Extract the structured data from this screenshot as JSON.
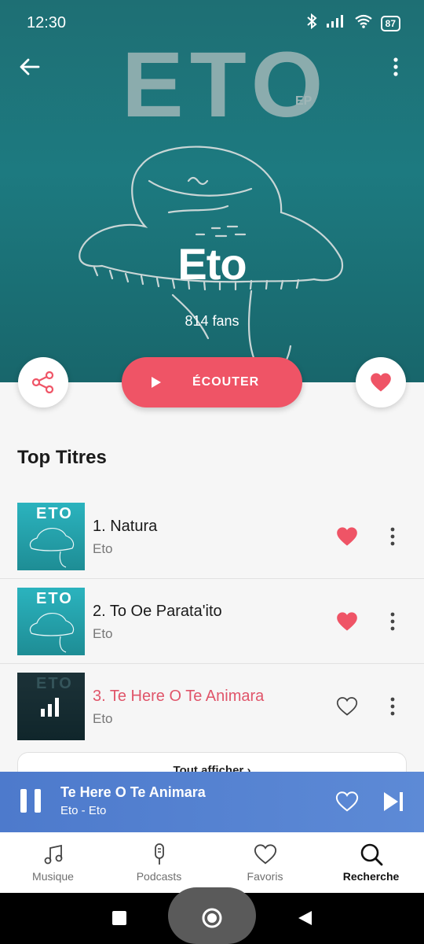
{
  "status_bar": {
    "time": "12:30",
    "battery": "87"
  },
  "artist": {
    "name": "Eto",
    "fans": "814 fans",
    "cover_text": "ETO",
    "cover_ep": "EP"
  },
  "actions": {
    "play_label": "ÉCOUTER"
  },
  "section_title": "Top Titres",
  "tracks": [
    {
      "title": "1. Natura",
      "artist": "Eto",
      "liked": true,
      "playing": false,
      "cover_text": "ETO"
    },
    {
      "title": "2. To Oe Parata'ito",
      "artist": "Eto",
      "liked": true,
      "playing": false,
      "cover_text": "ETO"
    },
    {
      "title": "3. Te Here O Te Animara",
      "artist": "Eto",
      "liked": false,
      "playing": true,
      "cover_text": "ETO"
    }
  ],
  "see_all_label": "Tout afficher",
  "see_all_arrow": "›",
  "player": {
    "title": "Te Here O Te Animara",
    "subtitle": "Eto - Eto"
  },
  "bottom_nav": [
    {
      "label": "Musique",
      "icon": "music-note-icon",
      "active": false
    },
    {
      "label": "Podcasts",
      "icon": "microphone-icon",
      "active": false
    },
    {
      "label": "Favoris",
      "icon": "heart-icon",
      "active": false
    },
    {
      "label": "Recherche",
      "icon": "search-icon",
      "active": true
    }
  ],
  "colors": {
    "accent": "#ef5466",
    "player_bg": "#5584d1",
    "hero_bg": "#1e7378"
  }
}
